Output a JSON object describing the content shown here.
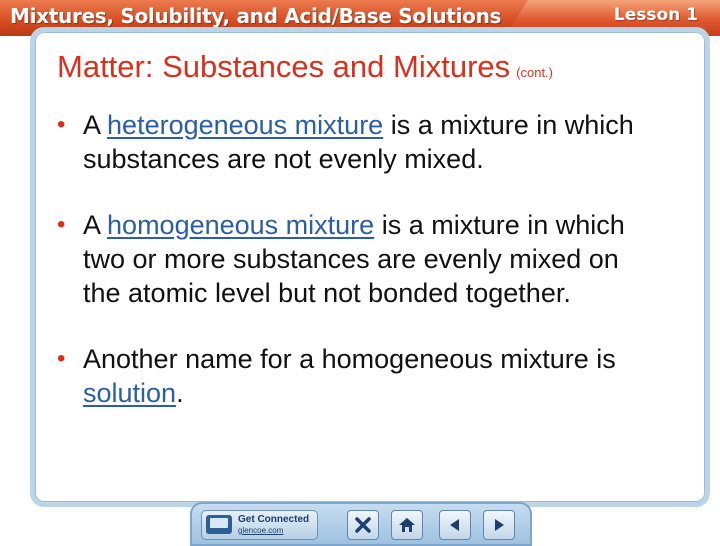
{
  "header": {
    "title": "Mixtures, Solubility, and Acid/Base Solutions",
    "lesson": "Lesson 1"
  },
  "slide": {
    "title": "Matter: Substances and Mixtures",
    "title_suffix": "(cont.)",
    "bullets": [
      {
        "pre": "A ",
        "term": "heterogeneous mixture",
        "post": " is a mixture in which substances are not evenly mixed."
      },
      {
        "pre": "A ",
        "term": "homogeneous mixture",
        "post": " is a mixture in which two or more substances are evenly mixed on the atomic level but not bonded together."
      },
      {
        "pre": "Another name for a homogeneous mixture is ",
        "term": "solution",
        "post": "."
      }
    ]
  },
  "nav": {
    "get_connected_label": "Get Connected",
    "get_connected_sub": "glencoe.com",
    "icons": [
      "close-icon",
      "home-icon",
      "previous-icon",
      "next-icon"
    ]
  },
  "colors": {
    "accent_red": "#d8301c",
    "term_blue": "#2b5ea5",
    "frame_blue": "#bcd4e8",
    "header_orange": "#d64b22"
  }
}
